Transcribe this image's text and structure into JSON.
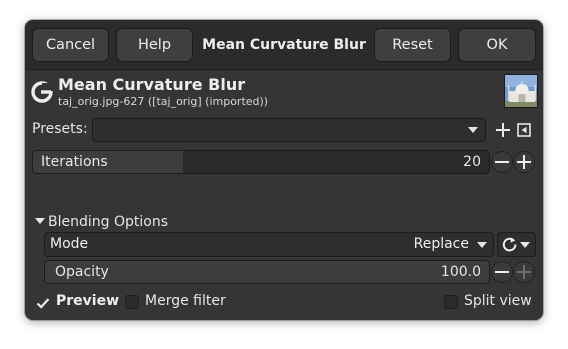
{
  "header": {
    "cancel_label": "Cancel",
    "help_label": "Help",
    "title": "Mean Curvature Blur",
    "reset_label": "Reset",
    "ok_label": "OK"
  },
  "filter": {
    "icon": "gimp-g-icon",
    "name": "Mean Curvature Blur",
    "subtitle": "taj_orig.jpg-627 ([taj_orig] (imported))",
    "thumbnail": "taj-mahal-thumbnail"
  },
  "presets": {
    "label": "Presets:",
    "value": "",
    "add_icon": "plus-icon",
    "menu_icon": "menu-arrow-icon"
  },
  "iterations": {
    "label": "Iterations",
    "value": "20",
    "fill_fraction": 0.33
  },
  "blending": {
    "header": "Blending Options",
    "mode_label": "Mode",
    "mode_value": "Replace",
    "cycle_icon": "reset-cycle-icon",
    "opacity_label": "Opacity",
    "opacity_value": "100.0",
    "opacity_fill_fraction": 1.0
  },
  "options": {
    "preview_label": "Preview",
    "preview_checked": true,
    "merge_label": "Merge filter",
    "merge_checked": false,
    "split_label": "Split view",
    "split_checked": false
  },
  "colors": {
    "dialog_bg": "#353535",
    "header_bg": "#2b2b2b",
    "text": "#e6e6e6"
  }
}
